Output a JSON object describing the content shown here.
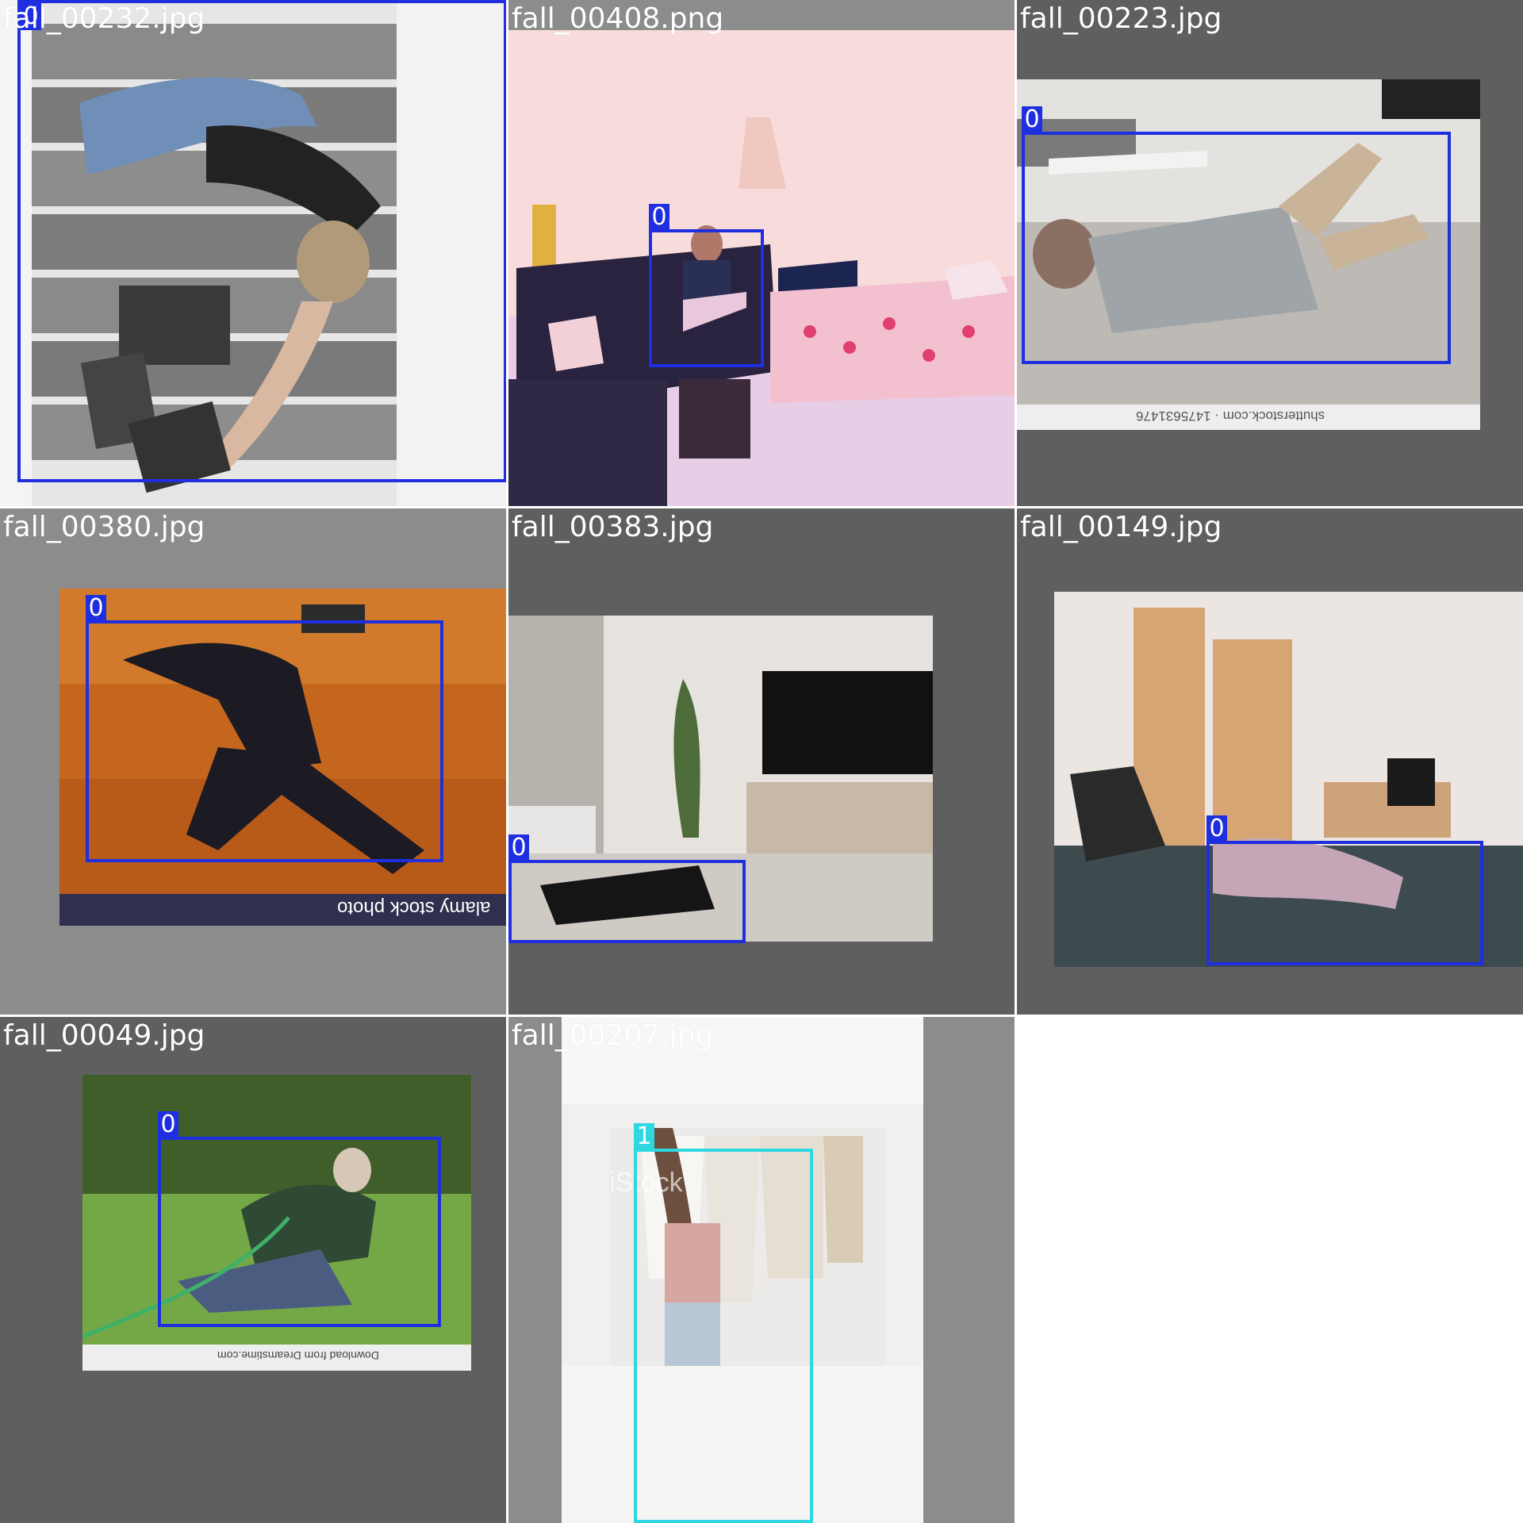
{
  "colors": {
    "class_0": "#1f2fe0",
    "class_1": "#2ed8e0",
    "label_text": "#ffffff"
  },
  "tiles": [
    {
      "filename": "fall_00232.jpg",
      "boxes": [
        {
          "class_label": "0"
        }
      ]
    },
    {
      "filename": "fall_00408.png",
      "boxes": [
        {
          "class_label": "0"
        }
      ]
    },
    {
      "filename": "fall_00223.jpg",
      "boxes": [
        {
          "class_label": "0"
        }
      ],
      "watermark": "shutterstock.com · 1475631476"
    },
    {
      "filename": "fall_00380.jpg",
      "boxes": [
        {
          "class_label": "0"
        }
      ],
      "watermark": "alamy stock photo"
    },
    {
      "filename": "fall_00383.jpg",
      "boxes": [
        {
          "class_label": "0"
        }
      ]
    },
    {
      "filename": "fall_00149.jpg",
      "boxes": [
        {
          "class_label": "0"
        }
      ]
    },
    {
      "filename": "fall_00049.jpg",
      "boxes": [
        {
          "class_label": "0"
        }
      ],
      "watermark": "Download from Dreamstime.com"
    },
    {
      "filename": "fall_00207.jpg",
      "boxes": [
        {
          "class_label": "1"
        }
      ],
      "watermark": "iStock"
    }
  ]
}
